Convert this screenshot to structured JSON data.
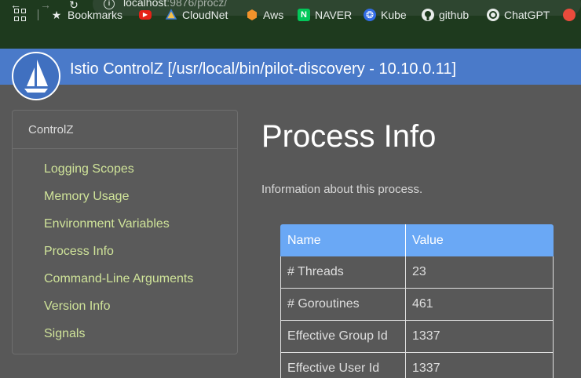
{
  "browser": {
    "url_host": "localhost",
    "url_path": ":9876/procz/",
    "bookmarks": [
      {
        "label": "Bookmarks",
        "icon": "star-icon"
      },
      {
        "label": "",
        "icon": "youtube-icon"
      },
      {
        "label": "CloudNet",
        "icon": "cloudnet-icon"
      },
      {
        "label": "Aws",
        "icon": "aws-icon"
      },
      {
        "label": "NAVER",
        "icon": "naver-icon"
      },
      {
        "label": "Kube",
        "icon": "kubernetes-icon"
      },
      {
        "label": "github",
        "icon": "github-icon"
      },
      {
        "label": "ChatGPT",
        "icon": "chatgpt-icon"
      }
    ]
  },
  "header": {
    "title": "Istio ControlZ [/usr/local/bin/pilot-discovery - 10.10.0.11]"
  },
  "sidebar": {
    "heading": "ControlZ",
    "items": [
      {
        "label": "Logging Scopes"
      },
      {
        "label": "Memory Usage"
      },
      {
        "label": "Environment Variables"
      },
      {
        "label": "Process Info"
      },
      {
        "label": "Command-Line Arguments"
      },
      {
        "label": "Version Info"
      },
      {
        "label": "Signals"
      }
    ]
  },
  "main": {
    "title": "Process Info",
    "description": "Information about this process.",
    "table": {
      "headers": [
        "Name",
        "Value"
      ],
      "rows": [
        [
          "# Threads",
          "23"
        ],
        [
          "# Goroutines",
          "461"
        ],
        [
          "Effective Group Id",
          "1337"
        ],
        [
          "Effective User Id",
          "1337"
        ]
      ]
    }
  },
  "colors": {
    "header_bg": "#4a7ac9",
    "link": "#cfe399",
    "table_header": "#6aa8f5",
    "browser_bar": "#1e3a1e"
  }
}
